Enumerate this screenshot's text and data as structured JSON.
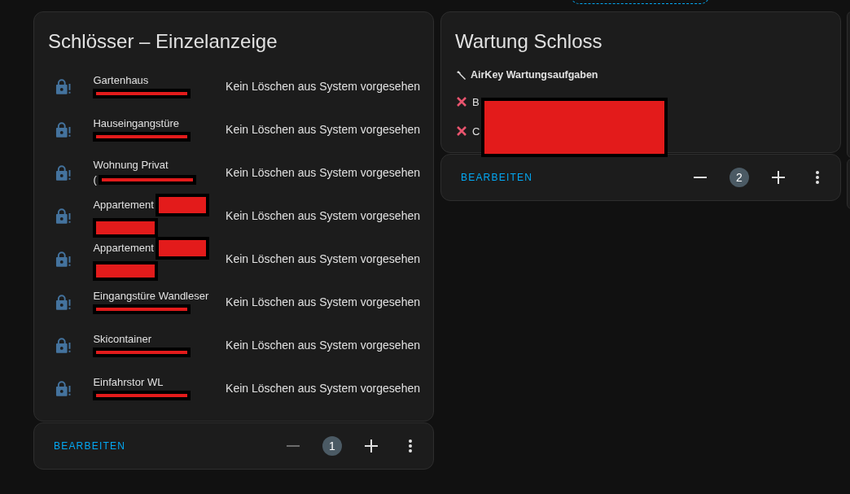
{
  "cards": [
    {
      "title": "Schlösser – Einzelanzeige",
      "kind": "locks",
      "rows": [
        {
          "name": "Gartenhaus",
          "name_redacted": false,
          "sub": "",
          "sub_redacted": true,
          "status": "Kein Löschen aus System vorgesehen"
        },
        {
          "name": "Hauseingangstüre",
          "name_redacted": false,
          "sub": "",
          "sub_redacted": true,
          "status": "Kein Löschen aus System vorgesehen"
        },
        {
          "name": "Wohnung Privat",
          "name_redacted": false,
          "sub": "(",
          "sub_redacted": true,
          "status": "Kein Löschen aus System vorgesehen"
        },
        {
          "name": "Appartement",
          "name_redacted": true,
          "sub": "",
          "sub_redacted": true,
          "status": "Kein Löschen aus System vorgesehen"
        },
        {
          "name": "Appartement",
          "name_redacted": true,
          "sub": "",
          "sub_redacted": true,
          "status": "Kein Löschen aus System vorgesehen"
        },
        {
          "name": "Eingangstüre Wandleser",
          "name_redacted": false,
          "sub": "",
          "sub_redacted": true,
          "status": "Kein Löschen aus System vorgesehen"
        },
        {
          "name": "Skicontainer",
          "name_redacted": false,
          "sub": "",
          "sub_redacted": true,
          "status": "Kein Löschen aus System vorgesehen"
        },
        {
          "name": "Einfahrstor WL",
          "name_redacted": false,
          "sub": "",
          "sub_redacted": true,
          "status": "Kein Löschen aus System vorgesehen"
        }
      ],
      "footer": {
        "edit": "BEARBEITEN",
        "minus_disabled": true,
        "count": "1"
      }
    },
    {
      "title": "Wartung Schloss",
      "kind": "tasks",
      "heading": "AirKey Wartungsaufgaben",
      "tasks": [
        {
          "text": "B"
        },
        {
          "text": "C"
        }
      ],
      "footer": {
        "edit": "BEARBEITEN",
        "minus_disabled": false,
        "count": "2"
      }
    }
  ]
}
